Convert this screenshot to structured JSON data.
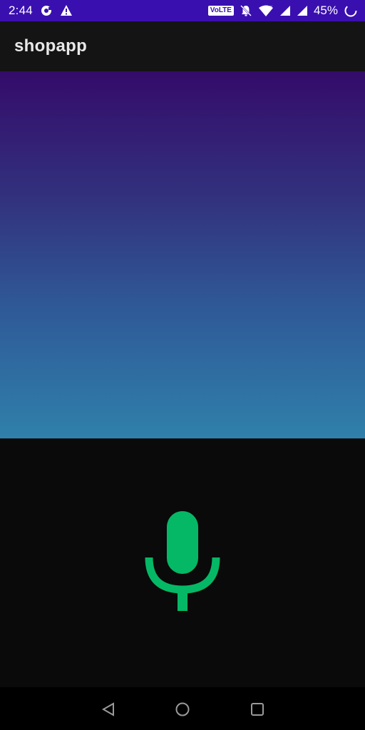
{
  "status_bar": {
    "time": "2:44",
    "volte_label": "VoLTE",
    "battery_percent": "45%",
    "background_color": "#3a0fb0",
    "icons": [
      "sync-icon",
      "warning-icon",
      "volte-icon",
      "mute-icon",
      "wifi-icon",
      "signal-icon",
      "signal-icon",
      "battery-saver-icon"
    ]
  },
  "app_bar": {
    "title": "shopapp"
  },
  "gradient_panel": {
    "colors": [
      "#340b6a",
      "#32327e",
      "#2f5a98",
      "#2f80aa"
    ]
  },
  "voice": {
    "icon": "microphone-icon",
    "color": "#05b865"
  },
  "nav_bar": {
    "buttons": [
      "back-icon",
      "home-icon",
      "recents-icon"
    ]
  }
}
